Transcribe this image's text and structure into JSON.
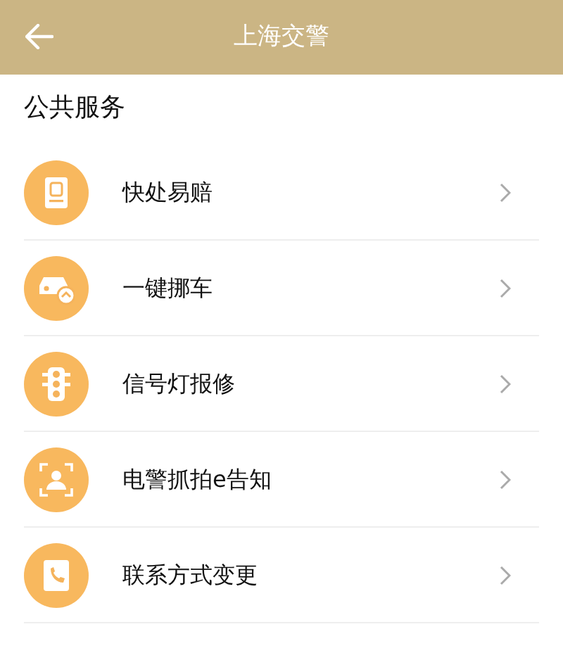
{
  "header": {
    "title": "上海交警"
  },
  "section": {
    "title": "公共服务"
  },
  "items": [
    {
      "kind": "document",
      "label": "快处易赔"
    },
    {
      "kind": "car",
      "label": "一键挪车"
    },
    {
      "kind": "traffic-light",
      "label": "信号灯报修"
    },
    {
      "kind": "person-frame",
      "label": "电警抓拍e告知"
    },
    {
      "kind": "phone-book",
      "label": "联系方式变更"
    }
  ]
}
